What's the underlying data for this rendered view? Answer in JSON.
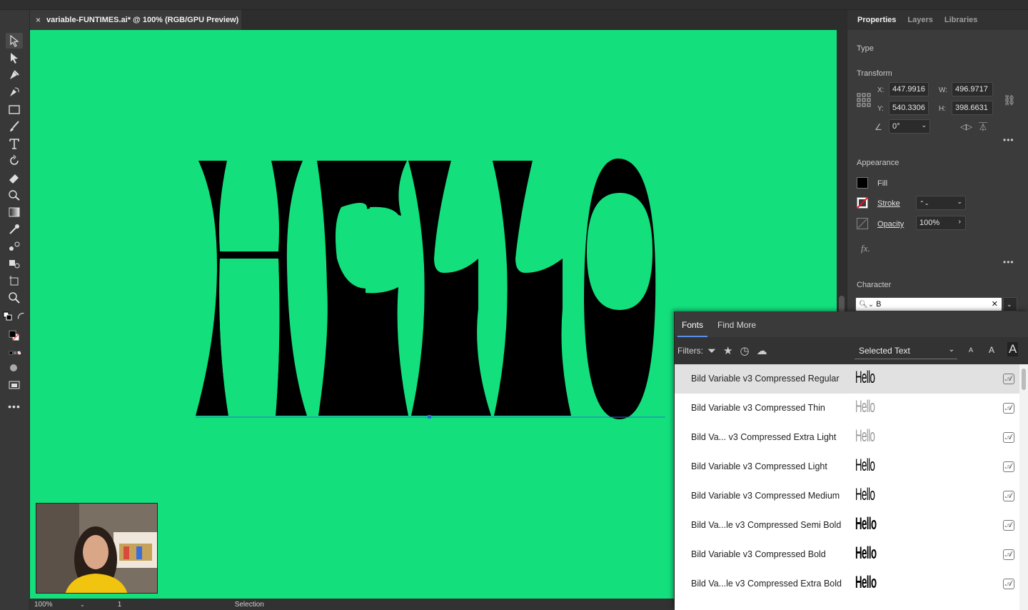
{
  "document": {
    "tab_title": "variable-FUNTIMES.ai* @ 100% (RGB/GPU Preview)",
    "close_glyph": "×"
  },
  "canvas": {
    "background": "#13e07d",
    "artwork_text": "HELLO",
    "artwork_color": "#000000"
  },
  "status": {
    "zoom": "100%",
    "artboard": "1",
    "tool": "Selection"
  },
  "properties": {
    "tabs": [
      "Properties",
      "Layers",
      "Libraries"
    ],
    "type_label": "Type",
    "transform_label": "Transform",
    "x_label": "X:",
    "x": "447.9916",
    "y_label": "Y:",
    "y": "540.3306",
    "w_label": "W:",
    "w": "496.9717",
    "h_label": "H:",
    "h": "398.6631",
    "angle": "0°",
    "appearance_label": "Appearance",
    "fill_label": "Fill",
    "stroke_label": "Stroke",
    "opacity_label": "Opacity",
    "opacity": "100%",
    "fx_label": "fx.",
    "character_label": "Character",
    "font_search": "B"
  },
  "fonts_panel": {
    "tabs": [
      "Fonts",
      "Find More"
    ],
    "filters_label": "Filters:",
    "preview_select": "Selected Text",
    "sample_text": "Hello",
    "font_rows": [
      {
        "name": "Bild Variable v3 Compressed Regular",
        "weight": 400,
        "selected": true
      },
      {
        "name": "Bild Variable v3 Compressed Thin",
        "weight": 100,
        "selected": false
      },
      {
        "name": "Bild Va... v3 Compressed Extra Light",
        "weight": 200,
        "selected": false
      },
      {
        "name": "Bild Variable v3 Compressed Light",
        "weight": 300,
        "selected": false
      },
      {
        "name": "Bild Variable v3 Compressed Medium",
        "weight": 500,
        "selected": false
      },
      {
        "name": "Bild Va...le v3 Compressed Semi Bold",
        "weight": 600,
        "selected": false
      },
      {
        "name": "Bild Variable v3 Compressed Bold",
        "weight": 700,
        "selected": false
      },
      {
        "name": "Bild Va...le v3 Compressed Extra Bold",
        "weight": 800,
        "selected": false
      }
    ]
  }
}
